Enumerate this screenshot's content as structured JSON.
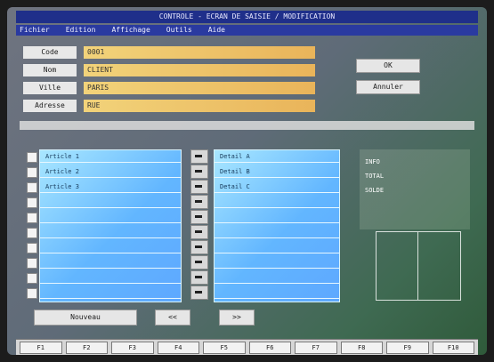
{
  "window": {
    "title": "CONTROLE - ECRAN DE SAISIE / MODIFICATION"
  },
  "menu": [
    {
      "label": "Fichier"
    },
    {
      "label": "Edition"
    },
    {
      "label": "Affichage"
    },
    {
      "label": "Outils"
    },
    {
      "label": "Aide"
    }
  ],
  "form": {
    "labels": {
      "field1": "Code",
      "field2": "Nom",
      "field3": "Ville",
      "field4": "Adresse"
    },
    "values": {
      "field1": "0001",
      "field2": "CLIENT",
      "field3": "PARIS",
      "field4": "RUE"
    },
    "buttons": {
      "ok": "OK",
      "cancel": "Annuler"
    }
  },
  "list": {
    "left_items": [
      "Article 1",
      "Article 2",
      "Article 3",
      "",
      "",
      "",
      "",
      "",
      "",
      ""
    ],
    "right_items": [
      "Detail A",
      "Detail B",
      "Detail C",
      "",
      "",
      "",
      "",
      "",
      "",
      ""
    ]
  },
  "side_panel": {
    "lines": [
      "INFO",
      "TOTAL",
      "SOLDE"
    ]
  },
  "bottom_buttons": {
    "new": "Nouveau",
    "prev": "<<",
    "next": ">>"
  },
  "function_keys": [
    "F1",
    "F2",
    "F3",
    "F4",
    "F5",
    "F6",
    "F7",
    "F8",
    "F9",
    "F10"
  ]
}
